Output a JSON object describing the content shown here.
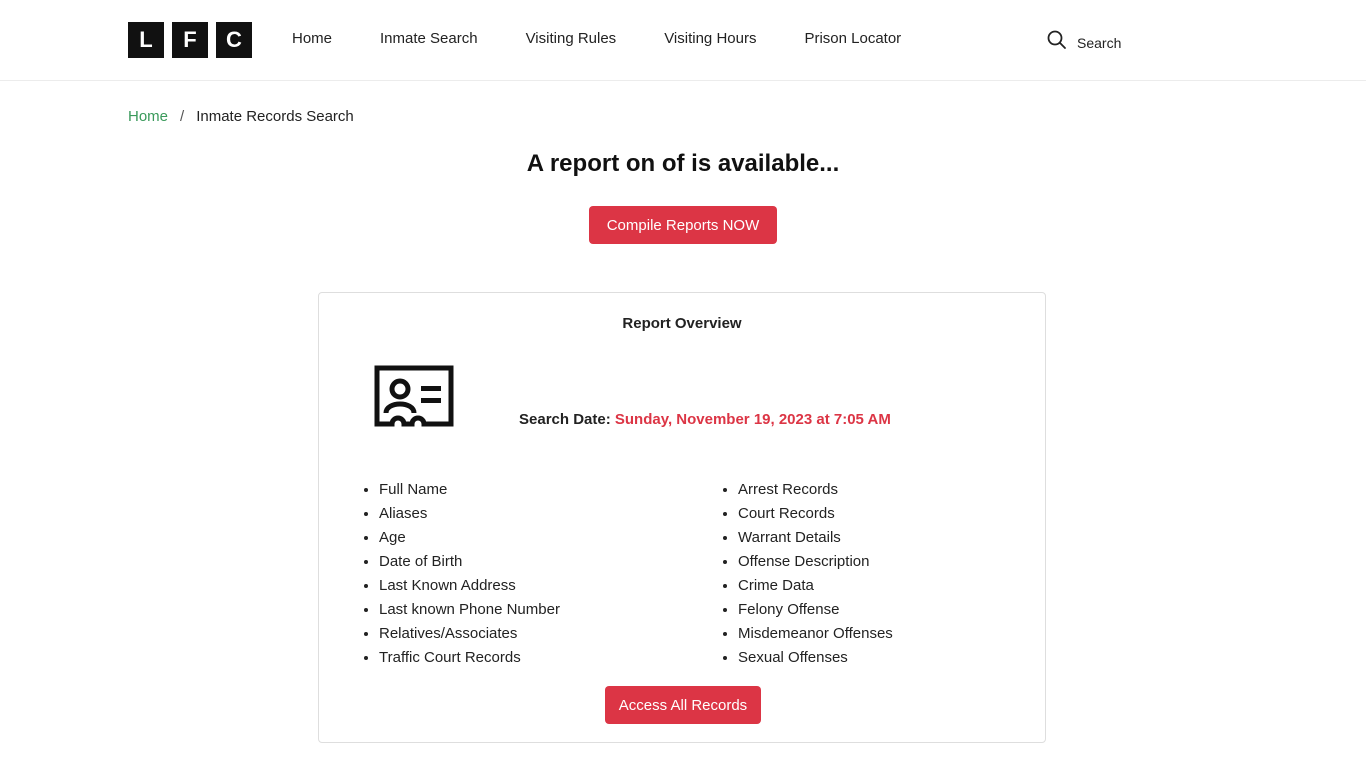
{
  "header": {
    "logo_letters": [
      "L",
      "F",
      "C"
    ],
    "nav": [
      {
        "label": "Home"
      },
      {
        "label": "Inmate Search"
      },
      {
        "label": "Visiting Rules"
      },
      {
        "label": "Visiting Hours"
      },
      {
        "label": "Prison Locator"
      }
    ],
    "search_label": "Search"
  },
  "breadcrumb": {
    "home": "Home",
    "separator": "/",
    "current": "Inmate Records Search"
  },
  "main": {
    "headline": "A report on of is available...",
    "compile_button": "Compile Reports NOW"
  },
  "card": {
    "title": "Report Overview",
    "search_date_label": "Search Date:",
    "search_date_value": "Sunday, November 19, 2023 at 7:05 AM",
    "left_items": [
      "Full Name",
      "Aliases",
      "Age",
      "Date of Birth",
      "Last Known Address",
      "Last known Phone Number",
      "Relatives/Associates",
      "Traffic Court Records"
    ],
    "right_items": [
      "Arrest Records",
      "Court Records",
      "Warrant Details",
      "Offense Description",
      "Crime Data",
      "Felony Offense",
      "Misdemeanor Offenses",
      "Sexual Offenses"
    ],
    "access_button": "Access All Records"
  },
  "colors": {
    "accent": "#dc3545",
    "link": "#3a9a5b",
    "logo_bg": "#111111"
  },
  "icons": {
    "search": "search-icon",
    "id_card": "id-card-icon"
  }
}
